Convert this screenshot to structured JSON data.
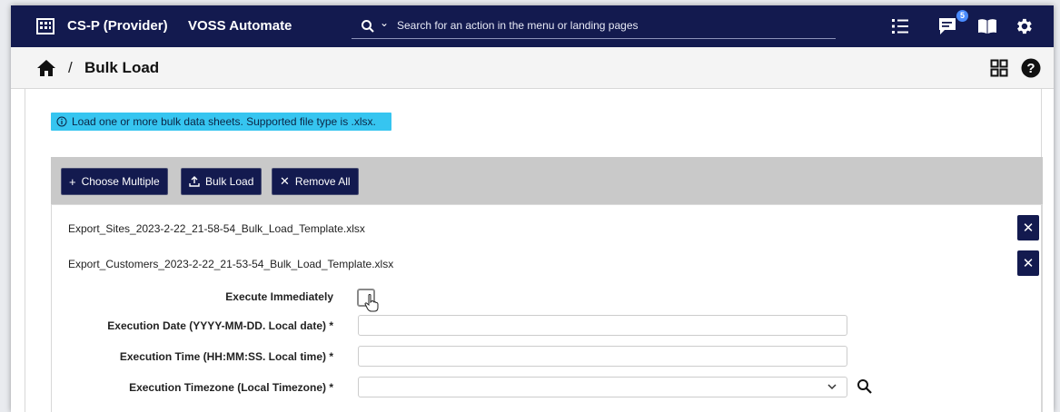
{
  "header": {
    "brand_icon": "building-icon",
    "tenant": "CS-P (Provider)",
    "app_name": "VOSS Automate",
    "search": {
      "placeholder": "Search for an action in the menu or landing pages"
    },
    "icons": [
      "list-icon",
      "messages-icon",
      "book-icon",
      "gear-icon"
    ],
    "messages_badge": "5"
  },
  "breadcrumb": {
    "separator": "/",
    "title": "Bulk Load"
  },
  "info_message": "Load one or more bulk data sheets. Supported file type is .xlsx.",
  "toolbar": {
    "choose_multiple": "Choose Multiple",
    "bulk_load": "Bulk Load",
    "remove_all": "Remove All"
  },
  "files": [
    "Export_Sites_2023-2-22_21-58-54_Bulk_Load_Template.xlsx",
    "Export_Customers_2023-2-22_21-53-54_Bulk_Load_Template.xlsx"
  ],
  "form": {
    "execute_immediately": "Execute Immediately",
    "execution_date": "Execution Date (YYYY-MM-DD. Local date) *",
    "execution_time": "Execution Time (HH:MM:SS. Local time) *",
    "execution_timezone": "Execution Timezone (Local Timezone) *",
    "execution_date_value": "",
    "execution_time_value": "",
    "execution_timezone_value": ""
  },
  "colors": {
    "nav": "#131a4f",
    "info": "#36c5f0",
    "toolbar": "#c9c9c9"
  }
}
